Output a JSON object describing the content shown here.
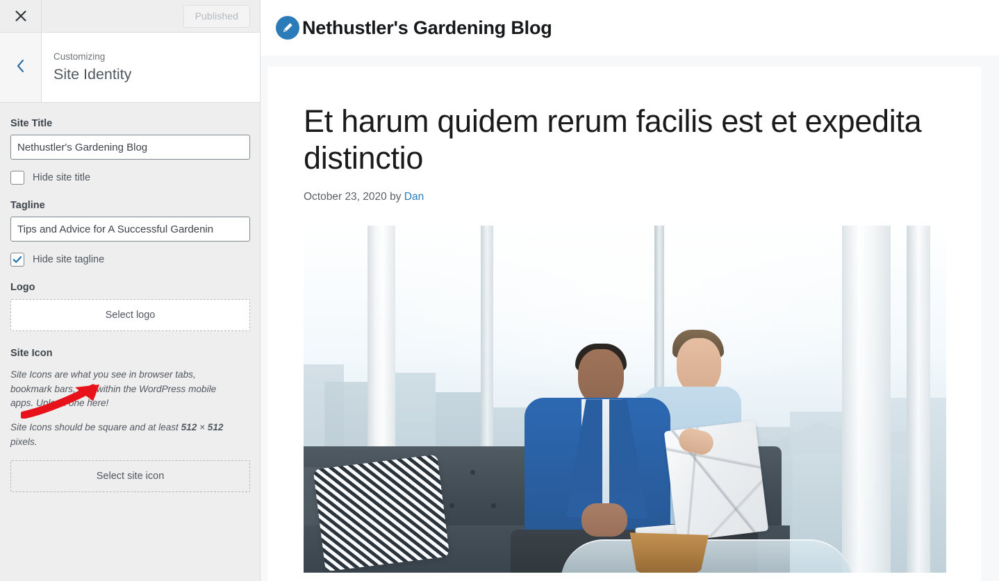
{
  "customizer": {
    "close_icon": "close-icon",
    "published_label": "Published",
    "back_icon": "chevron-left-icon",
    "kicker": "Customizing",
    "section_title": "Site Identity",
    "accent_color": "#1b74ba",
    "fields": {
      "site_title": {
        "label": "Site Title",
        "value": "Nethustler's Gardening Blog"
      },
      "hide_site_title": {
        "label": "Hide site title",
        "checked": false
      },
      "tagline": {
        "label": "Tagline",
        "value": "Tips and Advice for A Successful Gardenin"
      },
      "hide_site_tagline": {
        "label": "Hide site tagline",
        "checked": true
      },
      "logo": {
        "label": "Logo",
        "button_label": "Select logo"
      },
      "site_icon": {
        "label": "Site Icon",
        "help_1": "Site Icons are what you see in browser tabs, bookmark bars, and within the WordPress mobile apps. Upload one here!",
        "help_2_before": "Site Icons should be square and at least ",
        "help_2_bold_a": "512",
        "help_2_times": " × ",
        "help_2_bold_b": "512",
        "help_2_after": " pixels.",
        "button_label": "Select site icon"
      }
    }
  },
  "annotation": {
    "arrow_color": "#e8121a",
    "name": "red-arrow-pointing-to-site-icon"
  },
  "preview": {
    "site_logo_icon": "pencil-edit-icon",
    "site_logo_color": "#2b7bb9",
    "site_title": "Nethustler's Gardening Blog",
    "post": {
      "title": "Et harum quidem rerum facilis est et expedita distinctio",
      "date": "October 23, 2020",
      "by_label": " by ",
      "author": "Dan",
      "featured_image_alt": "Two men sitting on a dark leather sofa looking at a laptop by floor-to-ceiling office windows with a city skyline"
    }
  }
}
